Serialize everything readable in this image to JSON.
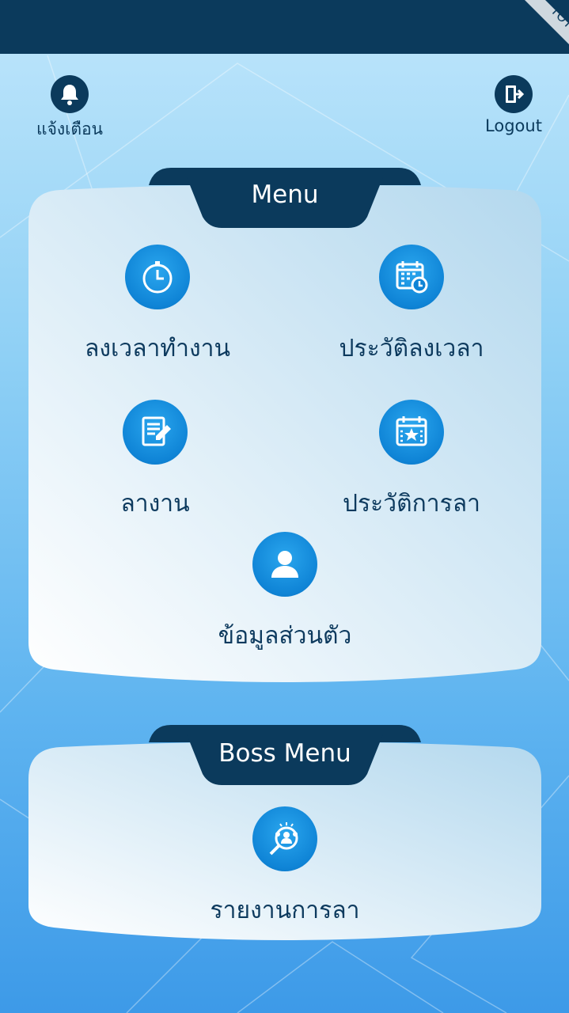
{
  "header": {
    "notify_label": "แจ้งเตือน",
    "logout_label": "Logout",
    "brand_ribbon": "TOT"
  },
  "menu": {
    "title": "Menu",
    "items": [
      {
        "label": "ลงเวลาทำงาน",
        "icon": "clock-icon"
      },
      {
        "label": "ประวัติลงเวลา",
        "icon": "calendar-clock-icon"
      },
      {
        "label": "ลางาน",
        "icon": "document-edit-icon"
      },
      {
        "label": "ประวัติการลา",
        "icon": "calendar-star-icon"
      },
      {
        "label": "ข้อมูลส่วนตัว",
        "icon": "user-icon"
      }
    ]
  },
  "boss_menu": {
    "title": "Boss Menu",
    "items": [
      {
        "label": "รายงานการลา",
        "icon": "search-people-icon"
      }
    ]
  },
  "colors": {
    "primary_dark": "#0b3a5c",
    "icon_blue": "#0f84d6",
    "text_dark": "#0d3a5e"
  }
}
